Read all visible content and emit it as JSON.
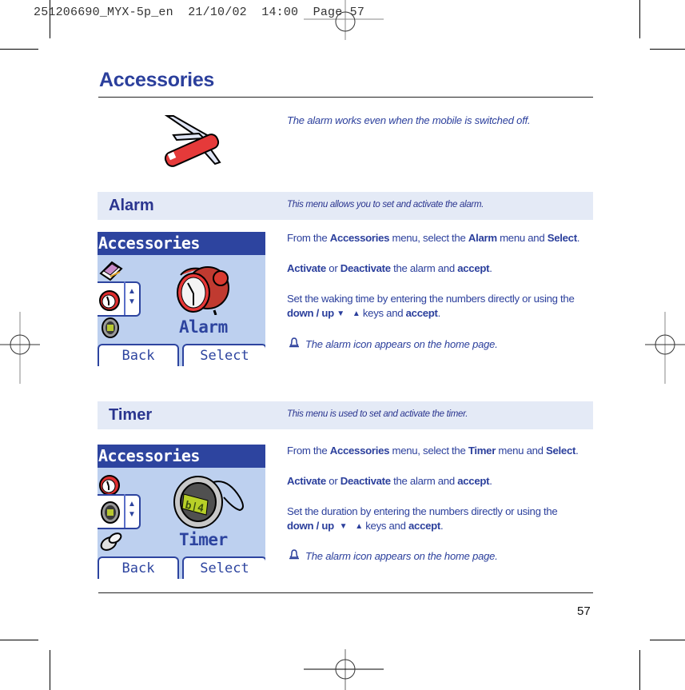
{
  "print_slug": "251206690_MYX-5p_en  21/10/02  14:00  Page 57",
  "page": {
    "title": "Accessories",
    "intro_note": "The alarm works even when the mobile  is switched off.",
    "intro_icon": "pocket-knife-icon",
    "page_number": "57"
  },
  "sections": [
    {
      "title": "Alarm",
      "description": "This menu allows you to set and activate the alarm.",
      "screen": {
        "header": "Accessories",
        "items": [
          "notepad-icon",
          "alarm-clock-icon",
          "timer-icon"
        ],
        "selected_index": 1,
        "big_label": "Alarm",
        "big_icon": "alarm-clock-icon",
        "softkeys": {
          "left": "Back",
          "right": "Select"
        }
      },
      "steps": {
        "s1_a": "From the ",
        "s1_b": "Accessories",
        "s1_c": " menu, select the ",
        "s1_d": "Alarm",
        "s1_e": " menu and ",
        "s1_f": "Select",
        "s1_g": ".",
        "s2_a": "Activate",
        "s2_b": " or ",
        "s2_c": "Deactivate",
        "s2_d": " the alarm and ",
        "s2_e": "accept",
        "s2_f": ".",
        "s3_a": "Set the waking time by entering the numbers directly or using the",
        "s3_b": "down / up",
        "s3_down": "▼",
        "s3_up": "▲",
        "s3_c": " keys and ",
        "s3_d": "accept",
        "s3_e": "."
      },
      "note": "The alarm icon appears on the home page."
    },
    {
      "title": "Timer",
      "description": "This menu is used to set and activate the timer.",
      "screen": {
        "header": "Accessories",
        "items": [
          "alarm-clock-icon",
          "timer-icon",
          "keys-icon"
        ],
        "selected_index": 1,
        "big_label": "Timer",
        "big_icon": "stopwatch-icon",
        "softkeys": {
          "left": "Back",
          "right": "Select"
        }
      },
      "steps": {
        "s1_a": "From the ",
        "s1_b": "Accessories",
        "s1_c": " menu, select the ",
        "s1_d": "Timer",
        "s1_e": " menu and ",
        "s1_f": "Select",
        "s1_g": ".",
        "s2_a": "Activate",
        "s2_b": " or ",
        "s2_c": "Deactivate",
        "s2_d": " the alarm and ",
        "s2_e": "accept",
        "s2_f": ".",
        "s3_a": "Set the duration by entering the numbers directly or using the",
        "s3_b": "down / up",
        "s3_down": "▼",
        "s3_up": "▲",
        "s3_c": " keys and ",
        "s3_d": "accept",
        "s3_e": "."
      },
      "note": "The alarm icon appears on the home page."
    }
  ],
  "colors": {
    "brand_blue": "#2b3f9c",
    "band_bg": "#e4eaf6",
    "screen_bg": "#bdd0ef",
    "screen_header": "#2d449f"
  }
}
